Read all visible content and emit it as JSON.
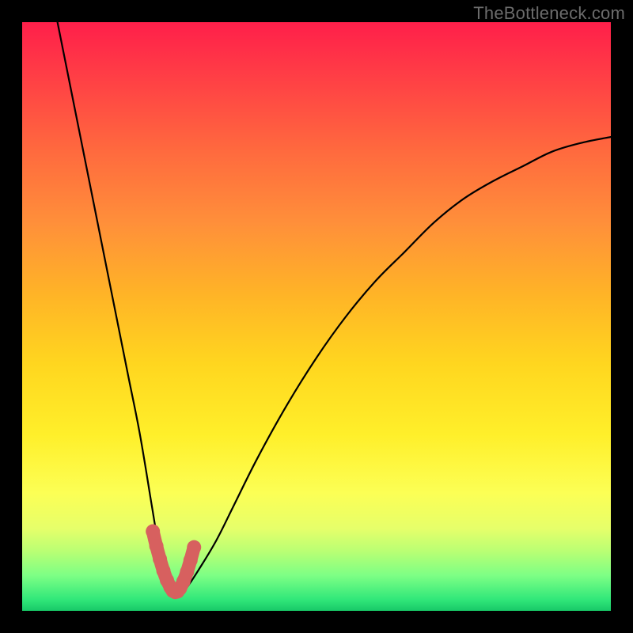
{
  "watermark": "TheBottleneck.com",
  "chart_data": {
    "type": "line",
    "title": "",
    "xlabel": "",
    "ylabel": "",
    "xlim": [
      0,
      100
    ],
    "ylim": [
      0,
      100
    ],
    "grid": false,
    "legend": false,
    "annotations": [],
    "series": [
      {
        "name": "main-curve",
        "color": "#000000",
        "x": [
          6,
          8,
          10,
          12,
          14,
          16,
          18,
          20,
          22,
          23,
          24,
          25,
          26,
          27,
          28,
          30,
          33,
          36,
          40,
          45,
          50,
          55,
          60,
          65,
          70,
          75,
          80,
          85,
          90,
          95,
          100
        ],
        "y": [
          100,
          90,
          80,
          70,
          60,
          50,
          40,
          30,
          18,
          12,
          7,
          4,
          3,
          3,
          4,
          7,
          12,
          18,
          26,
          35,
          43,
          50,
          56,
          61,
          66,
          70,
          73,
          75.5,
          78,
          79.5,
          80.5
        ]
      },
      {
        "name": "highlight-segment",
        "color": "#d7605f",
        "x": [
          22.2,
          22.8,
          23.4,
          24.0,
          24.6,
          25.2,
          25.6,
          26.0,
          26.4,
          26.8,
          27.4,
          28.0,
          28.6,
          29.2
        ],
        "y": [
          13.5,
          11.0,
          8.8,
          6.8,
          5.2,
          4.0,
          3.4,
          3.2,
          3.3,
          3.8,
          5.0,
          6.6,
          8.6,
          10.8
        ]
      }
    ]
  }
}
